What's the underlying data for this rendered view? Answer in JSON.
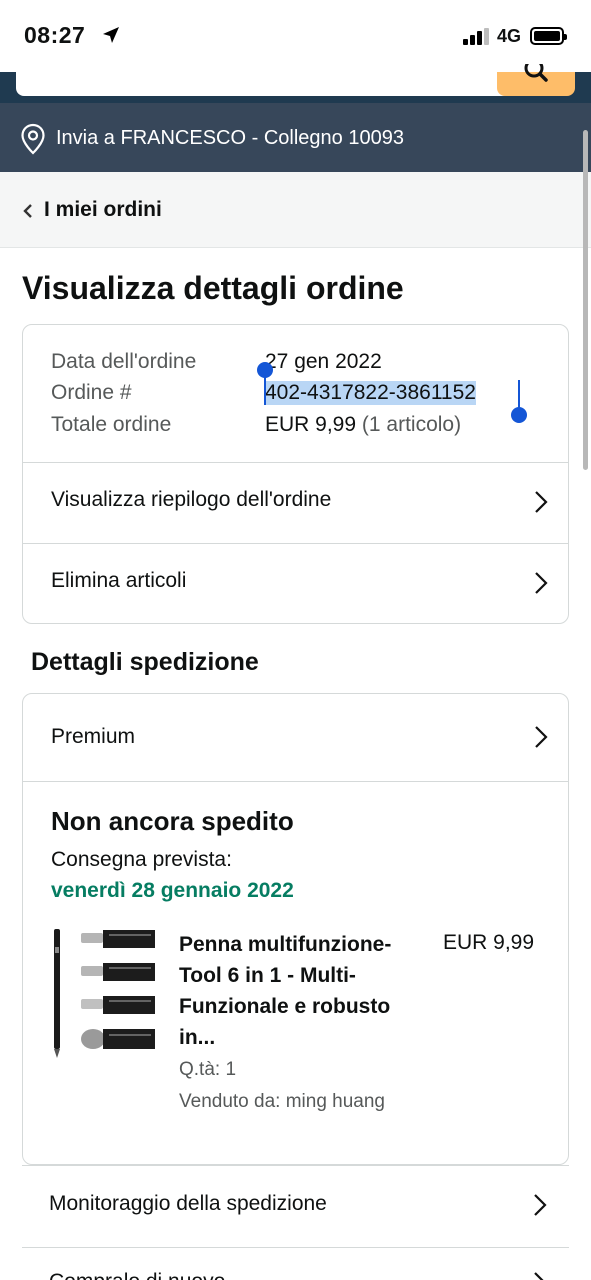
{
  "status_bar": {
    "time": "08:27",
    "network": "4G"
  },
  "header": {
    "delivery_text": "Invia a FRANCESCO - Collegno 10093"
  },
  "breadcrumb": {
    "label": "I miei ordini"
  },
  "page": {
    "title": "Visualizza dettagli ordine"
  },
  "order_summary": {
    "date_label": "Data dell'ordine",
    "date_value": "27 gen 2022",
    "number_label": "Ordine #",
    "number_value": "402-4317822-3861152",
    "total_label": "Totale ordine",
    "total_value": "EUR 9,99",
    "total_items": "(1 articolo)",
    "links": [
      "Visualizza riepilogo dell'ordine",
      "Elimina articoli"
    ]
  },
  "shipment": {
    "section_title": "Dettagli spedizione",
    "method": "Premium",
    "status": "Non ancora spedito",
    "delivery_label": "Consegna prevista:",
    "delivery_date": "venerdì 28 gennaio 2022",
    "delivery_date_color": "#067d62",
    "product": {
      "title_lines": [
        "Penna multifunzione-",
        "Tool 6 in 1 - Multi-",
        "Funzionale e robusto",
        "in..."
      ],
      "price": "EUR 9,99",
      "quantity": "Q.tà: 1",
      "seller": "Venduto da: ming huang"
    }
  },
  "bottom_links": [
    "Monitoraggio della spedizione",
    "Compralo di nuovo"
  ],
  "colors": {
    "header_dark": "#1f3a50",
    "delivery_bar": "#37475a",
    "search_button": "#febd69",
    "selection": "#b9d6f5",
    "handle": "#1456d6"
  }
}
